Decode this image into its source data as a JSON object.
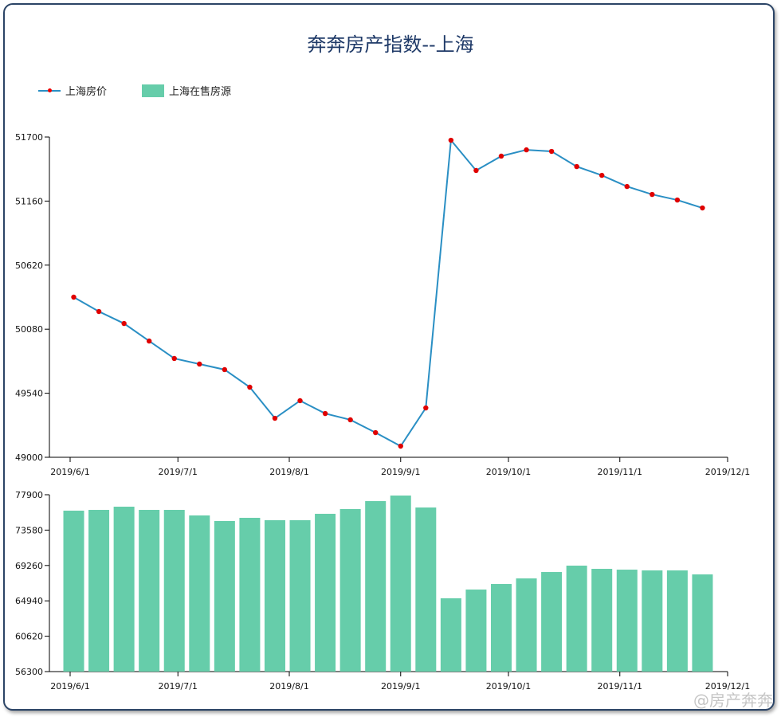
{
  "title": "奔奔房产指数--上海",
  "legend": [
    {
      "label": "上海房价"
    },
    {
      "label": "上海在售房源"
    }
  ],
  "watermark": "@房产奔奔",
  "colors": {
    "line": "#2a8fc4",
    "point": "#e00000",
    "bar": "#66cdaa",
    "title": "#1f3a68"
  },
  "chart_data": [
    {
      "type": "line",
      "name": "上海房价",
      "x": [
        "2019-06-02",
        "2019-06-09",
        "2019-06-16",
        "2019-06-23",
        "2019-06-30",
        "2019-07-07",
        "2019-07-14",
        "2019-07-21",
        "2019-07-28",
        "2019-08-04",
        "2019-08-11",
        "2019-08-18",
        "2019-08-25",
        "2019-09-01",
        "2019-09-08",
        "2019-09-15",
        "2019-09-22",
        "2019-09-29",
        "2019-10-06",
        "2019-10-13",
        "2019-10-20",
        "2019-10-27",
        "2019-11-03",
        "2019-11-10",
        "2019-11-17",
        "2019-11-24"
      ],
      "values": [
        50350,
        50229,
        50128,
        49980,
        49833,
        49786,
        49739,
        49591,
        49329,
        49477,
        49369,
        49316,
        49208,
        49094,
        49416,
        51673,
        51418,
        51539,
        51592,
        51579,
        51451,
        51377,
        51283,
        51216,
        51169,
        51102
      ],
      "ylim": [
        49000,
        51700
      ],
      "yticks": [
        "49000",
        "49540",
        "50080",
        "50620",
        "51160",
        "51700"
      ],
      "xlim": [
        "2019-06-01",
        "2019-12-01"
      ],
      "xticks": [
        {
          "date": "2019-06-01",
          "label": "2019/6/1"
        },
        {
          "date": "2019-07-01",
          "label": "2019/7/1"
        },
        {
          "date": "2019-08-01",
          "label": "2019/8/1"
        },
        {
          "date": "2019-09-01",
          "label": "2019/9/1"
        },
        {
          "date": "2019-10-01",
          "label": "2019/10/1"
        },
        {
          "date": "2019-11-01",
          "label": "2019/11/1"
        },
        {
          "date": "2019-12-01",
          "label": "2019/12/1"
        }
      ]
    },
    {
      "type": "bar",
      "name": "上海在售房源",
      "x": [
        "2019-06-02",
        "2019-06-09",
        "2019-06-16",
        "2019-06-23",
        "2019-06-30",
        "2019-07-07",
        "2019-07-14",
        "2019-07-21",
        "2019-07-28",
        "2019-08-04",
        "2019-08-11",
        "2019-08-18",
        "2019-08-25",
        "2019-09-01",
        "2019-09-08",
        "2019-09-15",
        "2019-09-22",
        "2019-09-29",
        "2019-10-06",
        "2019-10-13",
        "2019-10-20",
        "2019-10-27",
        "2019-11-03",
        "2019-11-10",
        "2019-11-17",
        "2019-11-24"
      ],
      "values": [
        75955,
        76050,
        76440,
        76050,
        76050,
        75370,
        74690,
        75080,
        74790,
        74790,
        75570,
        76150,
        77120,
        77800,
        76340,
        65250,
        66320,
        67000,
        67680,
        68460,
        69240,
        68850,
        68750,
        68660,
        68660,
        68170
      ],
      "ylim": [
        56300,
        77900
      ],
      "yticks": [
        "56300",
        "60620",
        "64940",
        "69260",
        "73580",
        "77900"
      ],
      "xlim": [
        "2019-06-01",
        "2019-12-01"
      ],
      "xticks": [
        {
          "date": "2019-06-01",
          "label": "2019/6/1"
        },
        {
          "date": "2019-07-01",
          "label": "2019/7/1"
        },
        {
          "date": "2019-08-01",
          "label": "2019/8/1"
        },
        {
          "date": "2019-09-01",
          "label": "2019/9/1"
        },
        {
          "date": "2019-10-01",
          "label": "2019/10/1"
        },
        {
          "date": "2019-11-01",
          "label": "2019/11/1"
        },
        {
          "date": "2019-12-01",
          "label": "2019/12/1"
        }
      ]
    }
  ]
}
